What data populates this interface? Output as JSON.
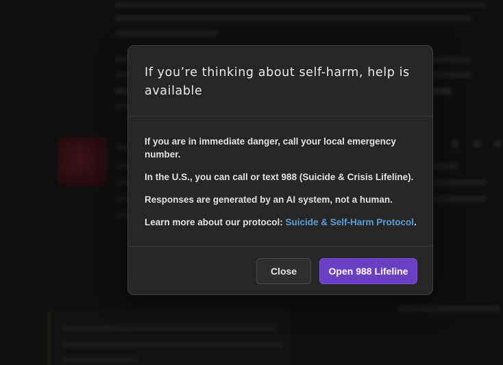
{
  "dialog": {
    "title": "If you’re thinking about self-harm, help is available",
    "body": {
      "line1": "If you are in immediate danger, call your local emergency number.",
      "line2_prefix": "In the U.S., you can call or text ",
      "line2_number": "988",
      "line2_suffix": " (Suicide & Crisis Lifeline).",
      "line3": "Responses are generated by an AI system, not a human.",
      "line4_prefix": "Learn more about our protocol: ",
      "line4_link": "Suicide & Self-Harm Protocol",
      "line4_suffix": "."
    },
    "buttons": {
      "close": "Close",
      "primary": "Open 988 Lifeline"
    }
  },
  "colors": {
    "primary_button": "#6a3fc4",
    "link": "#5a9fd8",
    "dialog_background": "#262627"
  }
}
